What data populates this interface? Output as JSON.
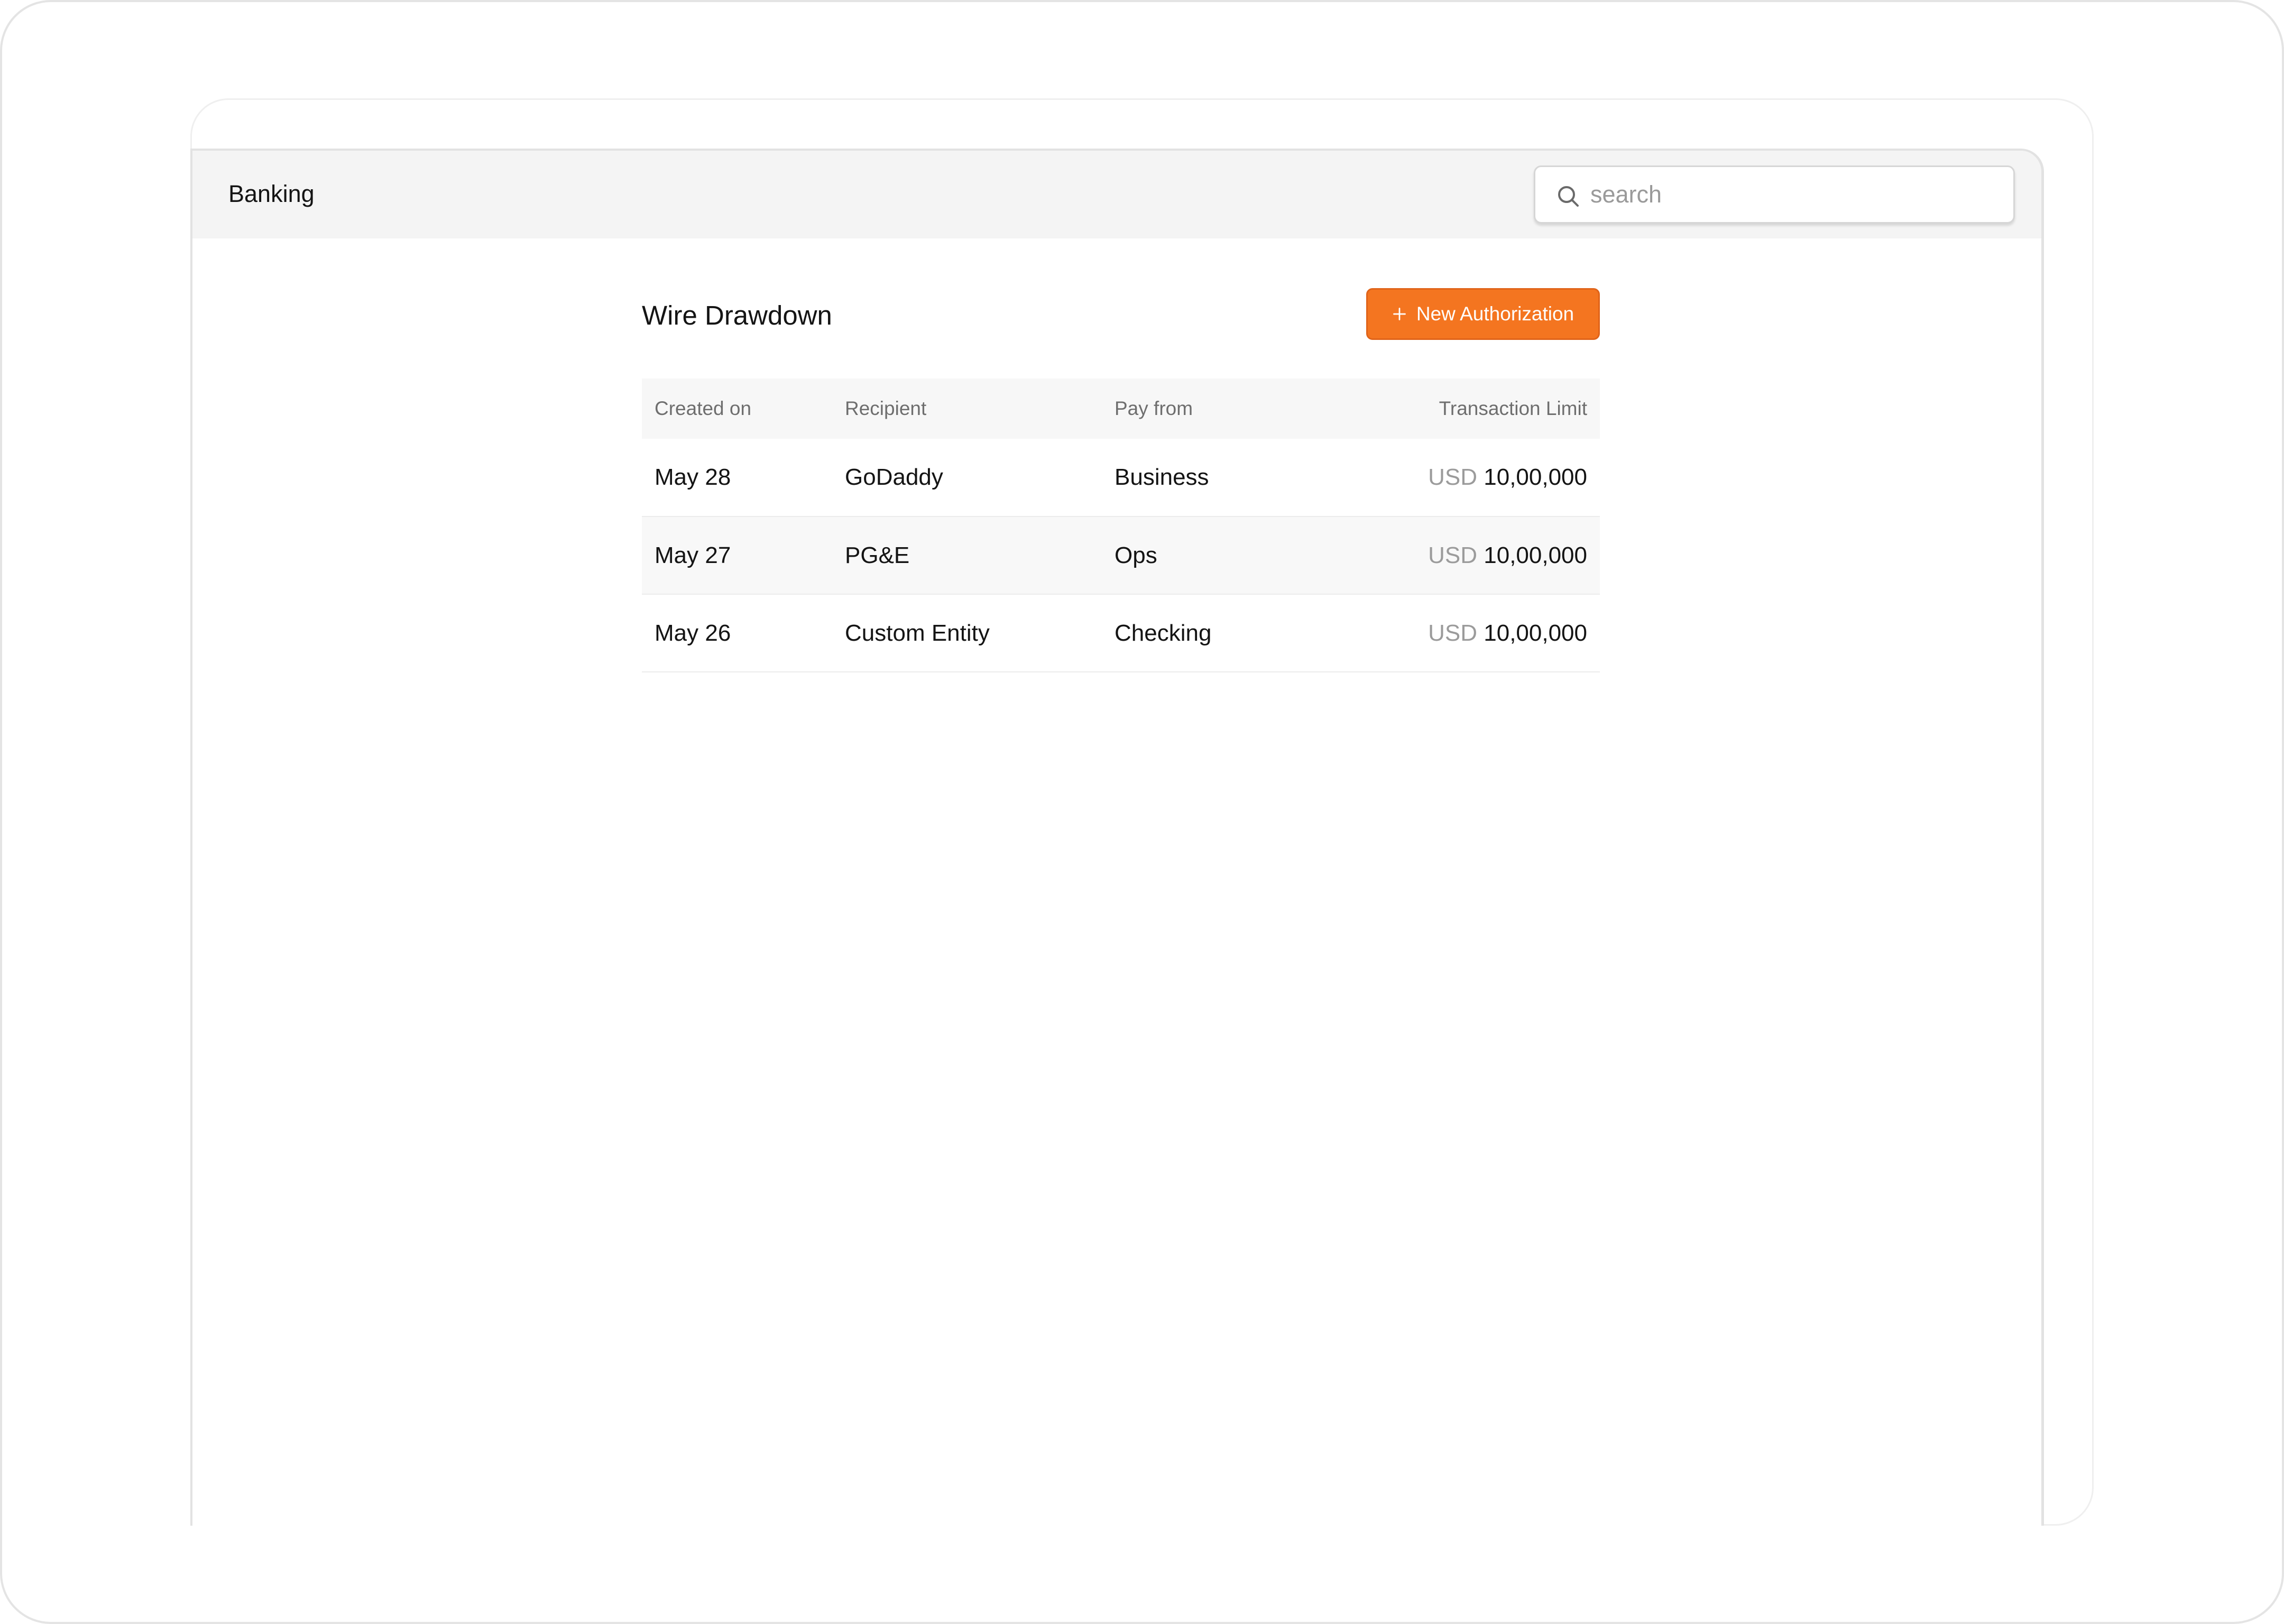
{
  "app": {
    "title": "Banking"
  },
  "search": {
    "placeholder": "search"
  },
  "page": {
    "title": "Wire Drawdown"
  },
  "actions": {
    "new_authorization_label": "New Authorization"
  },
  "table": {
    "columns": [
      "Created on",
      "Recipient",
      "Pay from",
      "Transaction Limit"
    ],
    "rows": [
      {
        "created_on": "May 28",
        "recipient": "GoDaddy",
        "pay_from": "Business",
        "currency": "USD",
        "limit": "10,00,000"
      },
      {
        "created_on": "May 27",
        "recipient": "PG&E",
        "pay_from": "Ops",
        "currency": "USD",
        "limit": "10,00,000"
      },
      {
        "created_on": "May 26",
        "recipient": "Custom Entity",
        "pay_from": "Checking",
        "currency": "USD",
        "limit": "10,00,000"
      }
    ]
  },
  "colors": {
    "accent": "#f47520",
    "header_bg": "#f4f4f4",
    "muted_text": "#9b9b9b"
  },
  "icons": {
    "search": "search-icon",
    "plus": "plus-icon"
  }
}
